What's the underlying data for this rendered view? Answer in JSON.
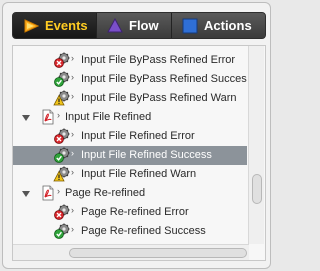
{
  "tabs": [
    {
      "label": "Events",
      "icon": "play-triangle-icon",
      "active": true
    },
    {
      "label": "Flow",
      "icon": "purple-triangle-icon",
      "active": false
    },
    {
      "label": "Actions",
      "icon": "blue-square-icon",
      "active": false
    }
  ],
  "tree": {
    "items": [
      {
        "label": "Input File ByPass Refined Error",
        "icon": "gear-error-icon",
        "kind": "event"
      },
      {
        "label": "Input File ByPass Refined Succes",
        "icon": "gear-success-icon",
        "kind": "event"
      },
      {
        "label": "Input File ByPass Refined Warn",
        "icon": "gear-warning-icon",
        "kind": "event"
      },
      {
        "label": "Input File Refined",
        "icon": "pdf-file-icon",
        "kind": "group",
        "expanded": true
      },
      {
        "label": "Input File Refined Error",
        "icon": "gear-error-icon",
        "kind": "event"
      },
      {
        "label": "Input File Refined Success",
        "icon": "gear-success-icon",
        "kind": "event",
        "selected": true
      },
      {
        "label": "Input File Refined Warn",
        "icon": "gear-warning-icon",
        "kind": "event"
      },
      {
        "label": "Page Re-refined",
        "icon": "pdf-file-icon",
        "kind": "group",
        "expanded": true
      },
      {
        "label": "Page Re-refined Error",
        "icon": "gear-error-icon",
        "kind": "event"
      },
      {
        "label": "Page Re-refined Success",
        "icon": "gear-success-icon",
        "kind": "event"
      }
    ]
  },
  "colors": {
    "active_tab_text": "#ffcc22",
    "selection": "#8c939a",
    "error": "#d9262b",
    "success": "#2fa33a",
    "warning": "#f0c419"
  }
}
